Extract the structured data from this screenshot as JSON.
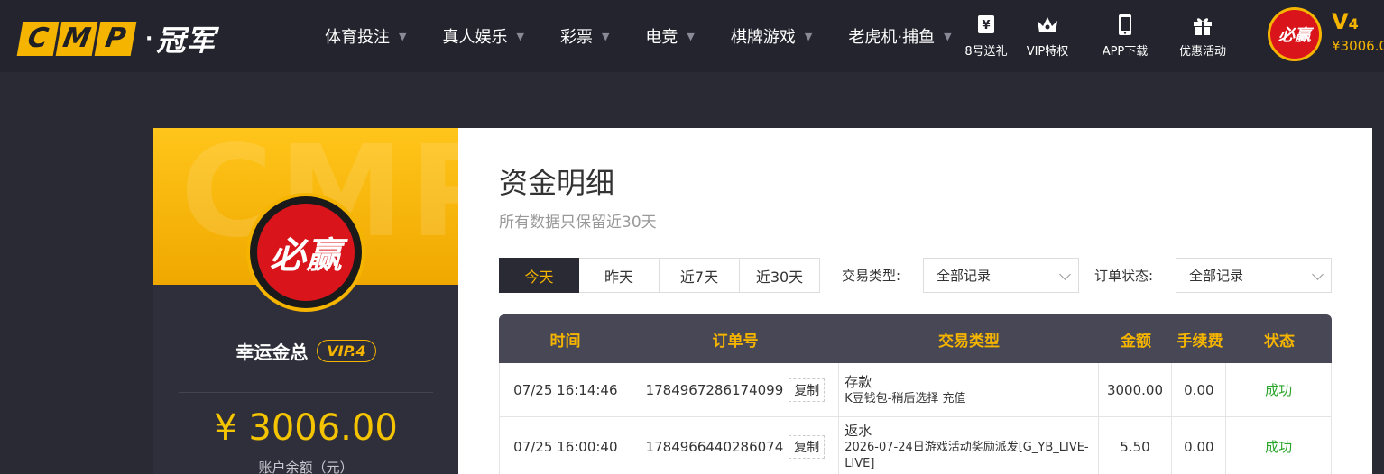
{
  "header": {
    "logo_letters": [
      "C",
      "M",
      "P"
    ],
    "logo_dot": "·",
    "logo_cn": "冠军",
    "nav": [
      {
        "label": "体育投注"
      },
      {
        "label": "真人娱乐"
      },
      {
        "label": "彩票"
      },
      {
        "label": "电竞"
      },
      {
        "label": "棋牌游戏"
      },
      {
        "label": "老虎机·捕鱼"
      }
    ],
    "tools": [
      {
        "label": "8号送礼",
        "icon": "money-icon"
      },
      {
        "label": "VIP特权",
        "icon": "crown-icon"
      },
      {
        "label": "APP下载",
        "icon": "phone-icon"
      },
      {
        "label": "优惠活动",
        "icon": "gift-icon"
      }
    ],
    "avatar_text": "必赢",
    "vip_level": "V",
    "vip_num": "4",
    "balance": "¥3006.0"
  },
  "profile": {
    "bg_text": "CMP",
    "avatar_text": "必赢",
    "username": "幸运金总",
    "vip_badge": "VIP.4",
    "balance": "¥ 3006.00",
    "balance_label": "账户余额（元）"
  },
  "content": {
    "title": "资金明细",
    "subtitle": "所有数据只保留近30天",
    "date_tabs": [
      "今天",
      "昨天",
      "近7天",
      "近30天"
    ],
    "filters": {
      "type_label": "交易类型:",
      "type_value": "全部记录",
      "status_label": "订单状态:",
      "status_value": "全部记录"
    },
    "table": {
      "headers": [
        "时间",
        "订单号",
        "交易类型",
        "金额",
        "手续费",
        "状态"
      ],
      "copy_label": "复制",
      "rows": [
        {
          "time": "07/25 16:14:46",
          "order": "1784967286174099",
          "type_main": "存款",
          "type_sub": "K豆钱包-稍后选择 充值",
          "amount": "3000.00",
          "fee": "0.00",
          "status": "成功"
        },
        {
          "time": "07/25 16:00:40",
          "order": "1784966440286074",
          "type_main": "返水",
          "type_sub": "2026-07-24日游戏活动奖励派发[G_YB_LIVE-LIVE]",
          "amount": "5.50",
          "fee": "0.00",
          "status": "成功"
        }
      ]
    }
  },
  "colors": {
    "accent": "#f5b400",
    "header_bg": "#24242e",
    "page_bg": "#2a2a35",
    "success": "#2aa52a",
    "brand_red": "#d9141b"
  }
}
